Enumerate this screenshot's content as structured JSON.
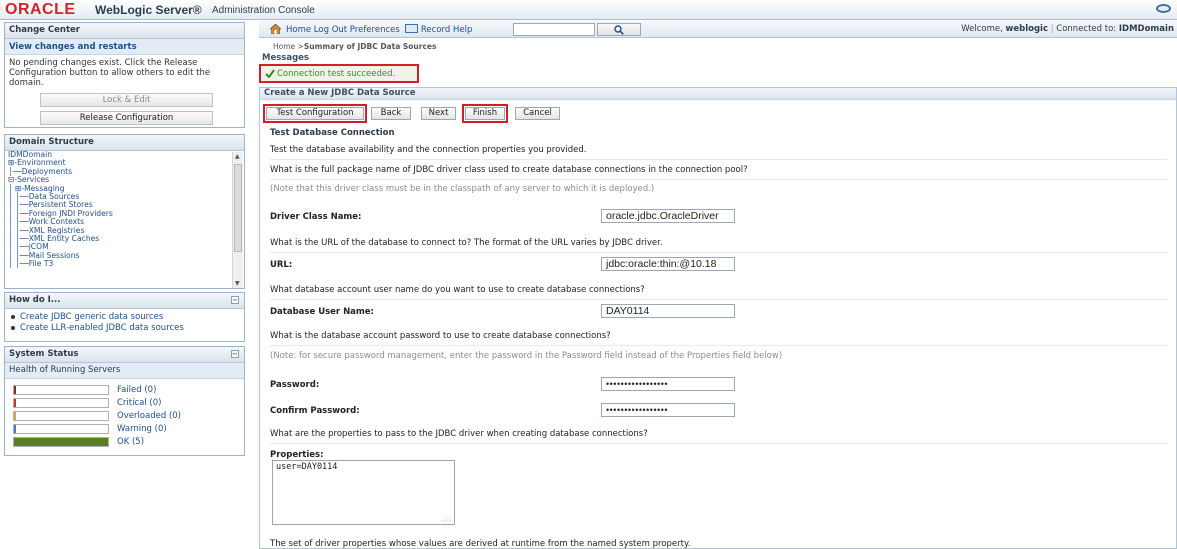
{
  "banner": {
    "oracle": "ORACLE",
    "product": "WebLogic Server®",
    "subtitle": "Administration Console"
  },
  "change_center": {
    "title": "Change Center",
    "link": "View changes and restarts",
    "text": "No pending changes exist. Click the Release Configuration button to allow others to edit the domain.",
    "lock_label": "Lock & Edit",
    "release_label": "Release Configuration"
  },
  "domain_structure": {
    "title": "Domain Structure",
    "items": [
      "IDMDomain",
      "⊞-Environment",
      "│──Deployments",
      "⊟-Services",
      "│  ⊞-Messaging",
      "│  │──Data Sources",
      "│  │──Persistent Stores",
      "│  │──Foreign JNDI Providers",
      "│  │──Work Contexts",
      "│  │──XML Registries",
      "│  │──XML Entity Caches",
      "│  │──jCOM",
      "│  │──Mail Sessions",
      "│  │──File T3"
    ]
  },
  "how_do_i": {
    "title": "How do I...",
    "items": [
      "Create JDBC generic data sources",
      "Create LLR-enabled JDBC data sources"
    ]
  },
  "system_status": {
    "title": "System Status",
    "subtitle": "Health of Running Servers",
    "rows": [
      {
        "label": "Failed (0)",
        "fraction": 0,
        "color": "#8b2a1f"
      },
      {
        "label": "Critical (0)",
        "fraction": 0,
        "color": "#c0392b"
      },
      {
        "label": "Overloaded (0)",
        "fraction": 0,
        "color": "#e6a23c"
      },
      {
        "label": "Warning (0)",
        "fraction": 0,
        "color": "#4a7ab8"
      },
      {
        "label": "OK (5)",
        "fraction": 1,
        "color": "#5a7f1e"
      }
    ]
  },
  "toolbar": {
    "links": "Home  Log Out  Preferences",
    "record": "Record",
    "help": "Help",
    "welcome_prefix": "Welcome, ",
    "user": "weblogic",
    "connected": "Connected to: ",
    "domain": "IDMDomain"
  },
  "breadcrumb": {
    "home": "Home",
    "sep": " >",
    "current": "Summary of JDBC Data Sources"
  },
  "messages": {
    "title": "Messages",
    "text": "Connection test succeeded."
  },
  "create": {
    "title": "Create a New JDBC Data Source",
    "buttons": {
      "test": "Test Configuration",
      "back": "Back",
      "next": "Next",
      "finish": "Finish",
      "cancel": "Cancel"
    },
    "section_title": "Test Database Connection",
    "section_desc": "Test the database availability and the connection properties you provided.",
    "q_driver": "What is the full package name of JDBC driver class used to create database connections in the connection pool?",
    "note_driver": "(Note that this driver class must be in the classpath of any server to which it is deployed.)",
    "driver_label": "Driver Class Name:",
    "driver_value": "oracle.jdbc.OracleDriver",
    "q_url": "What is the URL of the database to connect to? The format of the URL varies by JDBC driver.",
    "url_label": "URL:",
    "url_value": "jdbc:oracle:thin:@10.18",
    "q_user": "What database account user name do you want to use to create database connections?",
    "user_label": "Database User Name:",
    "user_value": "DAY0114",
    "q_pw": "What is the database account password to use to create database connections?",
    "note_pw": "(Note: for secure password management, enter the password in the Password field instead of the Properties field below)",
    "pw_label": "Password:",
    "pw_value": "•••••••••••••••••",
    "confirm_label": "Confirm Password:",
    "confirm_value": "•••••••••••••••••",
    "q_props": "What are the properties to pass to the JDBC driver when creating database connections?",
    "props_label": "Properties:",
    "props_value": "user=DAY0114",
    "q_sys": "The set of driver properties whose values are derived at runtime from the named system property."
  }
}
